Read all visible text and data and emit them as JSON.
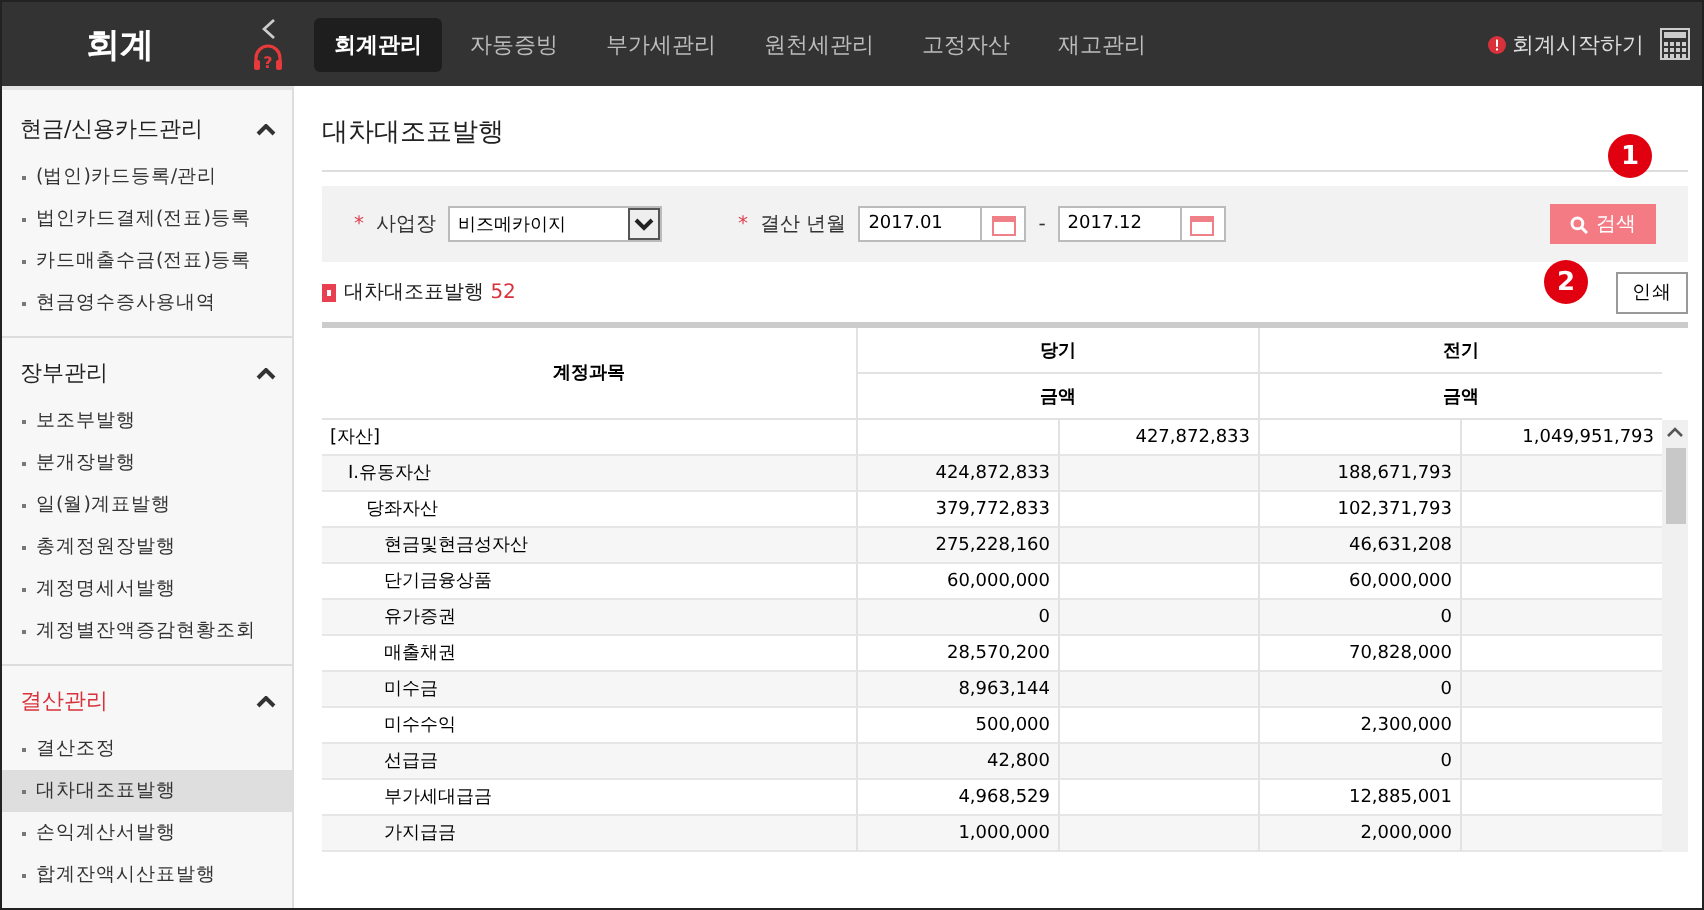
{
  "app": {
    "title": "회계",
    "help_label": "?"
  },
  "nav": [
    {
      "label": "회계관리",
      "selected": true
    },
    {
      "label": "자동증빙",
      "selected": false
    },
    {
      "label": "부가세관리",
      "selected": false
    },
    {
      "label": "원천세관리",
      "selected": false
    },
    {
      "label": "고정자산",
      "selected": false
    },
    {
      "label": "재고관리",
      "selected": false
    }
  ],
  "start_link": {
    "label": "회계시작하기"
  },
  "sidebar": [
    {
      "title": "현금/신용카드관리",
      "expanded": true,
      "active": false,
      "items": [
        {
          "label": "(법인)카드등록/관리",
          "selected": false
        },
        {
          "label": "법인카드결제(전표)등록",
          "selected": false
        },
        {
          "label": "카드매출수금(전표)등록",
          "selected": false
        },
        {
          "label": "현금영수증사용내역",
          "selected": false
        }
      ]
    },
    {
      "title": "장부관리",
      "expanded": true,
      "active": false,
      "items": [
        {
          "label": "보조부발행",
          "selected": false
        },
        {
          "label": "분개장발행",
          "selected": false
        },
        {
          "label": "일(월)계표발행",
          "selected": false
        },
        {
          "label": "총계정원장발행",
          "selected": false
        },
        {
          "label": "계정명세서발행",
          "selected": false
        },
        {
          "label": "계정별잔액증감현황조회",
          "selected": false
        }
      ]
    },
    {
      "title": "결산관리",
      "expanded": true,
      "active": true,
      "items": [
        {
          "label": "결산조정",
          "selected": false
        },
        {
          "label": "대차대조표발행",
          "selected": true
        },
        {
          "label": "손익계산서발행",
          "selected": false
        },
        {
          "label": "합계잔액시산표발행",
          "selected": false
        }
      ]
    }
  ],
  "page_title": "대차대조표발행",
  "filters": {
    "business_required": "*",
    "period_required": "*",
    "business_label": "사업장",
    "business_value": "비즈메카이지",
    "period_label": "결산 년월",
    "period_from": "2017.01",
    "period_separator": "-",
    "period_to": "2017.12",
    "search_button": "검색"
  },
  "callouts": [
    {
      "label": "1"
    },
    {
      "label": "2"
    }
  ],
  "section": {
    "title": "대차대조표발행",
    "count": "52",
    "print_button": "인쇄"
  },
  "table": {
    "columns": {
      "account": "계정과목",
      "current": "당기",
      "previous": "전기",
      "current_amount": "금액",
      "previous_amount": "금액"
    },
    "rows": [
      {
        "name": "[자산]",
        "current_total": "427,872,833",
        "previous_total": "1,049,951,793",
        "children": [
          {
            "name": "Ⅰ.유동자산",
            "current_sub": "424,872,833",
            "previous_sub": "188,671,793",
            "children": [
              {
                "name": "당좌자산",
                "current_sub": "379,772,833",
                "previous_sub": "102,371,793",
                "children": [
                  {
                    "name": "현금및현금성자산",
                    "current_sub": "275,228,160",
                    "previous_sub": "46,631,208"
                  },
                  {
                    "name": "단기금융상품",
                    "current_sub": "60,000,000",
                    "previous_sub": "60,000,000"
                  },
                  {
                    "name": "유가증권",
                    "current_sub": "0",
                    "previous_sub": "0"
                  },
                  {
                    "name": "매출채권",
                    "current_sub": "28,570,200",
                    "previous_sub": "70,828,000"
                  },
                  {
                    "name": "미수금",
                    "current_sub": "8,963,144",
                    "previous_sub": "0"
                  },
                  {
                    "name": "미수수익",
                    "current_sub": "500,000",
                    "previous_sub": "2,300,000"
                  },
                  {
                    "name": "선급금",
                    "current_sub": "42,800",
                    "previous_sub": "0"
                  },
                  {
                    "name": "부가세대급금",
                    "current_sub": "4,968,529",
                    "previous_sub": "12,885,001"
                  },
                  {
                    "name": "가지급금",
                    "current_sub": "1,000,000",
                    "previous_sub": "2,000,000"
                  }
                ]
              }
            ]
          }
        ]
      }
    ]
  }
}
